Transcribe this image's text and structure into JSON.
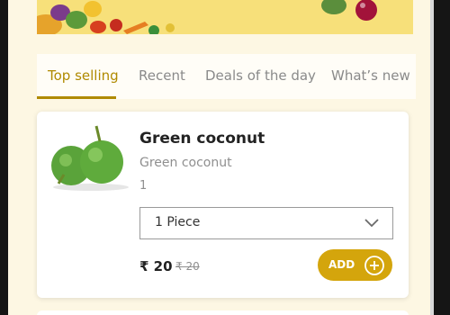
{
  "tabs": [
    {
      "label": "Top selling",
      "active": true
    },
    {
      "label": "Recent",
      "active": false
    },
    {
      "label": "Deals of the day",
      "active": false
    },
    {
      "label": "What’s new",
      "active": false
    }
  ],
  "product": {
    "title": "Green coconut",
    "subtitle": "Green coconut",
    "qty": "1",
    "unit_selected": "1 Piece",
    "price_now": "₹ 20",
    "price_old": "₹ 20",
    "add_label": "ADD"
  },
  "colors": {
    "accent": "#d4a50c",
    "tab_active": "#b08a00",
    "banner": "#f7e07a"
  },
  "icons": [
    "chevron-down-icon",
    "plus-icon"
  ]
}
